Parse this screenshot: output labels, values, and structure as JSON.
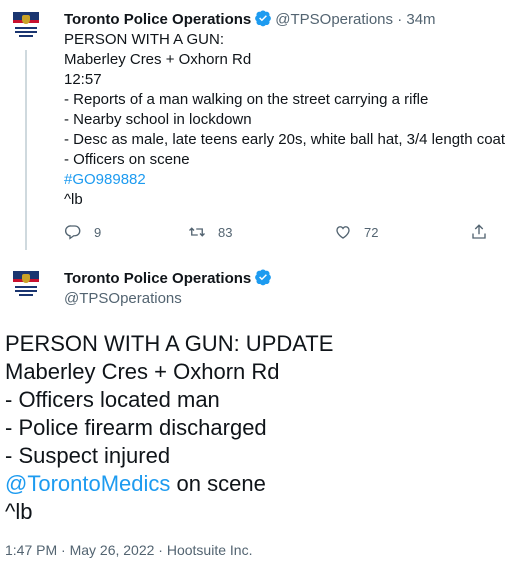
{
  "tweet1": {
    "name": "Toronto Police Operations",
    "handle": "@TPSOperations",
    "time": "34m",
    "lines": [
      "PERSON WITH A GUN:",
      "Maberley Cres + Oxhorn Rd",
      "12:57",
      "- Reports of a man walking on the street carrying a rifle",
      "- Nearby school in lockdown",
      "- Desc as male, late teens early 20s, white ball hat, 3/4 length coat",
      "- Officers on scene"
    ],
    "hashtag": "#GO989882",
    "sign": "^lb",
    "replies": "9",
    "retweets": "83",
    "likes": "72"
  },
  "tweet2": {
    "name": "Toronto Police Operations",
    "handle": "@TPSOperations",
    "lines_before": [
      "PERSON WITH A GUN: UPDATE",
      "Maberley Cres + Oxhorn Rd",
      "- Officers located man",
      "- Police firearm discharged",
      "- Suspect injured"
    ],
    "mention": "@TorontoMedics",
    "mention_suffix": " on scene",
    "sign": "^lb",
    "timestamp": "1:47 PM · May 26, 2022 · Hootsuite Inc."
  },
  "colors": {
    "link": "#1d9bf0",
    "verified": "#1d9bf0",
    "muted": "#536471"
  }
}
